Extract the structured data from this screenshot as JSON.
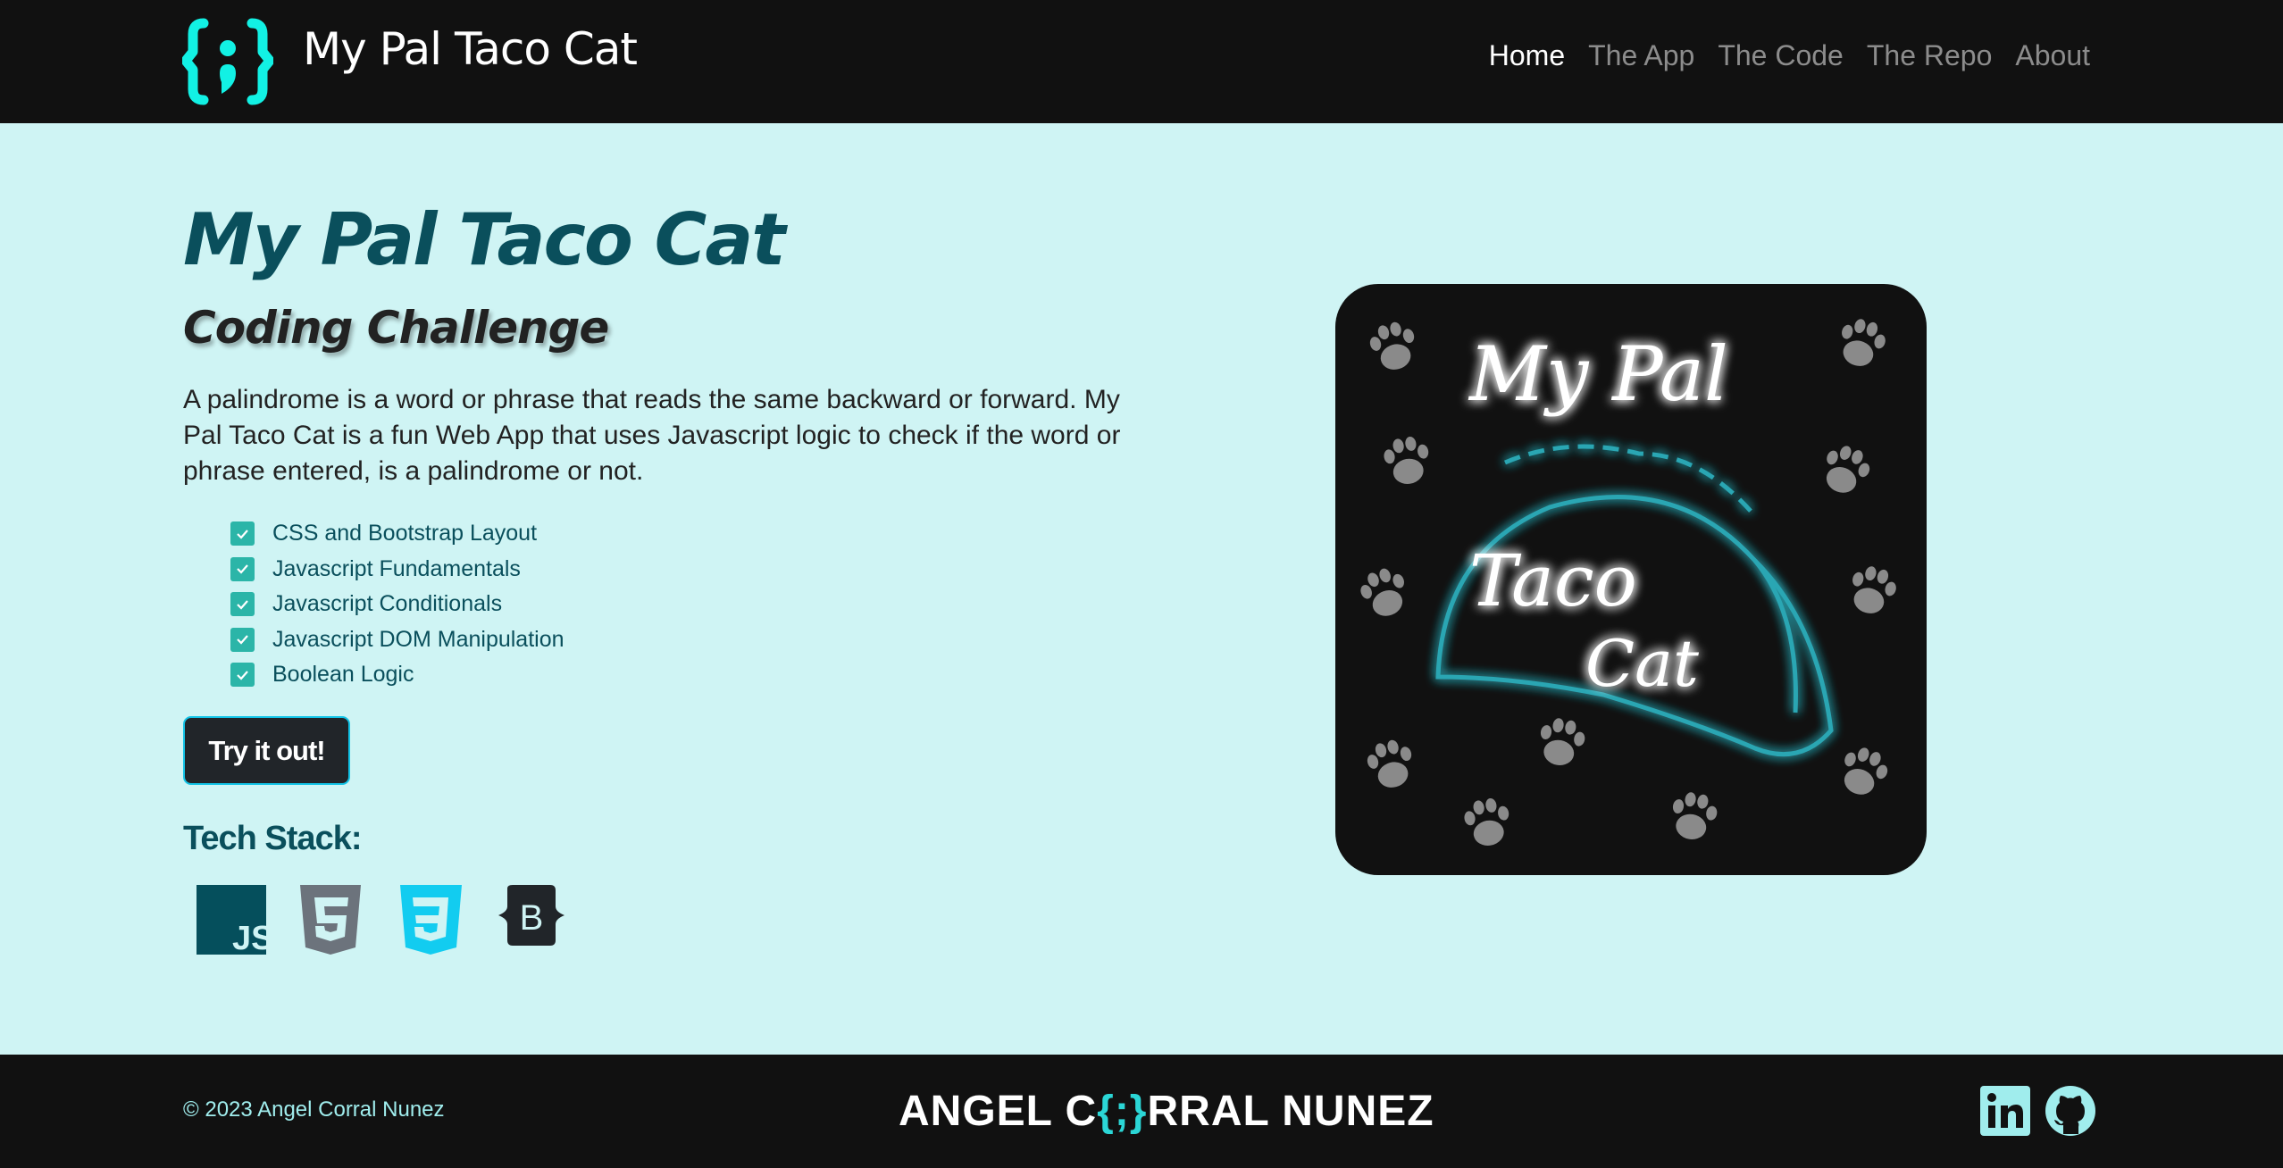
{
  "header": {
    "brand": "My Pal Taco Cat",
    "logo_icon": "curly-braces-semicolon-icon",
    "nav": [
      {
        "label": "Home",
        "active": true
      },
      {
        "label": "The App",
        "active": false
      },
      {
        "label": "The Code",
        "active": false
      },
      {
        "label": "The Repo",
        "active": false
      },
      {
        "label": "About",
        "active": false
      }
    ]
  },
  "main": {
    "title": "My Pal Taco Cat",
    "subtitle": "Coding Challenge",
    "description": "A palindrome is a word or phrase that reads the same backward or forward. My Pal Taco Cat is a fun Web App that uses Javascript logic to check if the word or phrase entered, is a palindrome or not.",
    "features": [
      "CSS and Bootstrap Layout",
      "Javascript Fundamentals",
      "Javascript Conditionals",
      "Javascript DOM Manipulation",
      "Boolean Logic"
    ],
    "cta_label": "Try it out!",
    "tech_stack_label": "Tech Stack:",
    "tech_stack_icons": [
      "javascript-icon",
      "html5-icon",
      "css3-icon",
      "bootstrap-icon"
    ],
    "hero_image": {
      "line1": "My Pal",
      "line2": "Taco",
      "line3": "Cat"
    }
  },
  "footer": {
    "copyright": "© 2023 Angel Corral Nunez",
    "brand_left": "ANGEL C",
    "brand_braces": "{;}",
    "brand_right": "RRAL NUNEZ",
    "social": [
      "linkedin-icon",
      "github-icon"
    ]
  },
  "colors": {
    "accent": "#12f1e4",
    "primary": "#0a4f5c",
    "background": "#cff4f4",
    "dark": "#111111",
    "check": "#2bb5a8"
  }
}
